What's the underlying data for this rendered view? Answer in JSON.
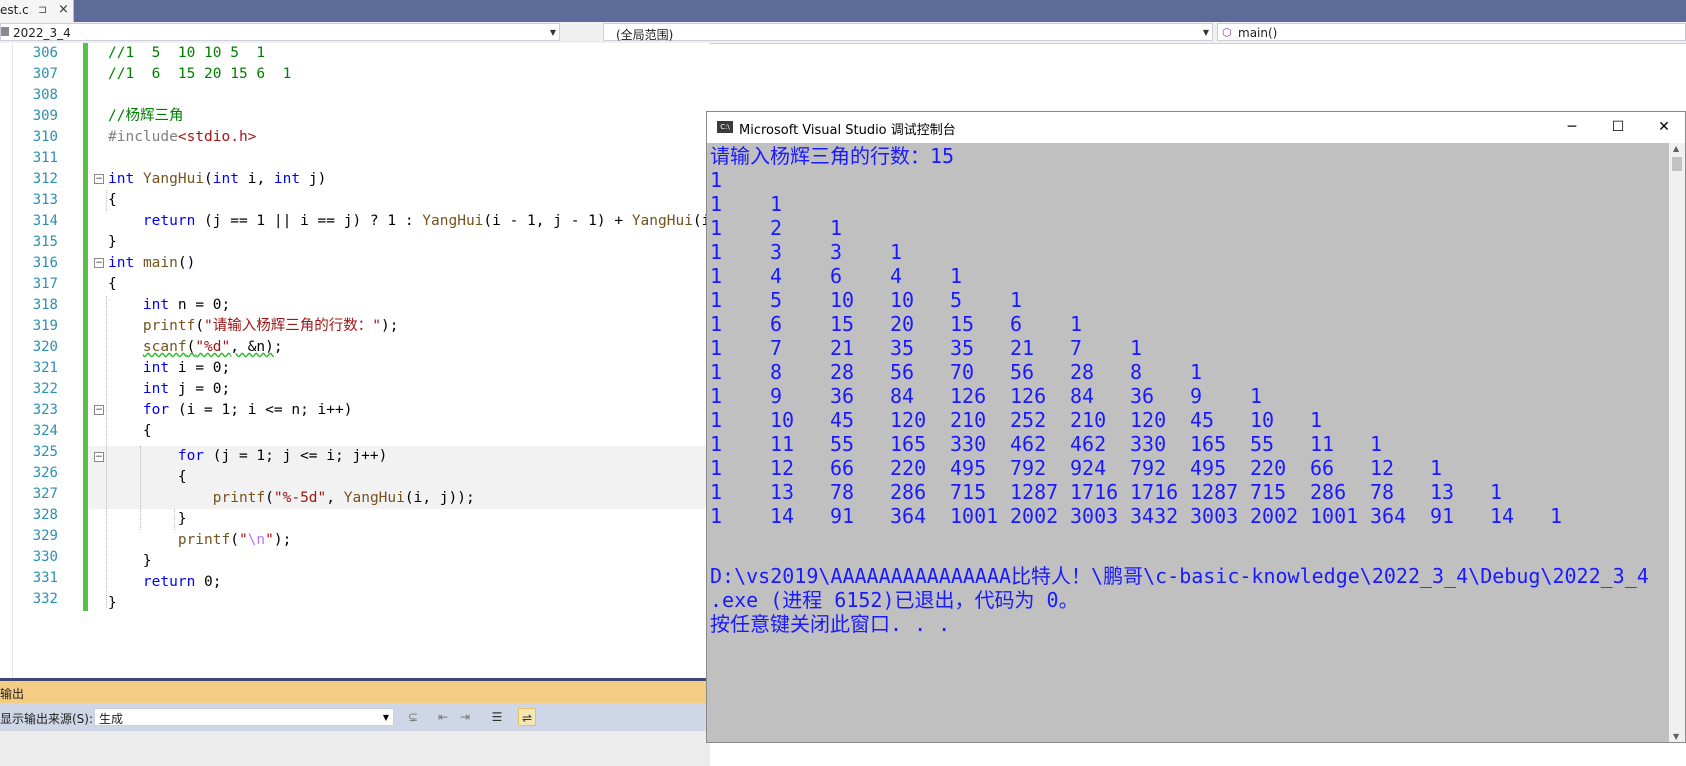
{
  "tab": {
    "title": "est.c",
    "pin": "⊐",
    "close": "×"
  },
  "nav": {
    "project": "2022_3_4",
    "scope": "(全局范围)",
    "function": "main()"
  },
  "editor": {
    "line_numbers": [
      "306",
      "307",
      "308",
      "309",
      "310",
      "311",
      "312",
      "313",
      "314",
      "315",
      "316",
      "317",
      "318",
      "319",
      "320",
      "321",
      "322",
      "323",
      "324",
      "325",
      "326",
      "327",
      "328",
      "329",
      "330",
      "331",
      "332"
    ]
  },
  "output": {
    "title": "输出",
    "source_label": "显示输出来源(S):",
    "source_value": "生成"
  },
  "console": {
    "title": "Microsoft Visual Studio 调试控制台",
    "prompt_line": "请输入杨辉三角的行数：15",
    "rows": [
      [
        "1"
      ],
      [
        "1",
        "1"
      ],
      [
        "1",
        "2",
        "1"
      ],
      [
        "1",
        "3",
        "3",
        "1"
      ],
      [
        "1",
        "4",
        "6",
        "4",
        "1"
      ],
      [
        "1",
        "5",
        "10",
        "10",
        "5",
        "1"
      ],
      [
        "1",
        "6",
        "15",
        "20",
        "15",
        "6",
        "1"
      ],
      [
        "1",
        "7",
        "21",
        "35",
        "35",
        "21",
        "7",
        "1"
      ],
      [
        "1",
        "8",
        "28",
        "56",
        "70",
        "56",
        "28",
        "8",
        "1"
      ],
      [
        "1",
        "9",
        "36",
        "84",
        "126",
        "126",
        "84",
        "36",
        "9",
        "1"
      ],
      [
        "1",
        "10",
        "45",
        "120",
        "210",
        "252",
        "210",
        "120",
        "45",
        "10",
        "1"
      ],
      [
        "1",
        "11",
        "55",
        "165",
        "330",
        "462",
        "462",
        "330",
        "165",
        "55",
        "11",
        "1"
      ],
      [
        "1",
        "12",
        "66",
        "220",
        "495",
        "792",
        "924",
        "792",
        "495",
        "220",
        "66",
        "12",
        "1"
      ],
      [
        "1",
        "13",
        "78",
        "286",
        "715",
        "1287",
        "1716",
        "1716",
        "1287",
        "715",
        "286",
        "78",
        "13",
        "1"
      ],
      [
        "1",
        "14",
        "91",
        "364",
        "1001",
        "2002",
        "3003",
        "3432",
        "3003",
        "2002",
        "1001",
        "364",
        "91",
        "14",
        "1"
      ]
    ],
    "exit_line1": "D:\\vs2019\\AAAAAAAAAAAAAAA比特人！\\鹏哥\\c-basic-knowledge\\2022_3_4\\Debug\\2022_3_4",
    "exit_line2": ".exe (进程 6152)已退出，代码为 0。",
    "press_key": "按任意键关闭此窗口. . .",
    "btn_min": "─",
    "btn_max": "☐",
    "btn_close": "✕"
  }
}
